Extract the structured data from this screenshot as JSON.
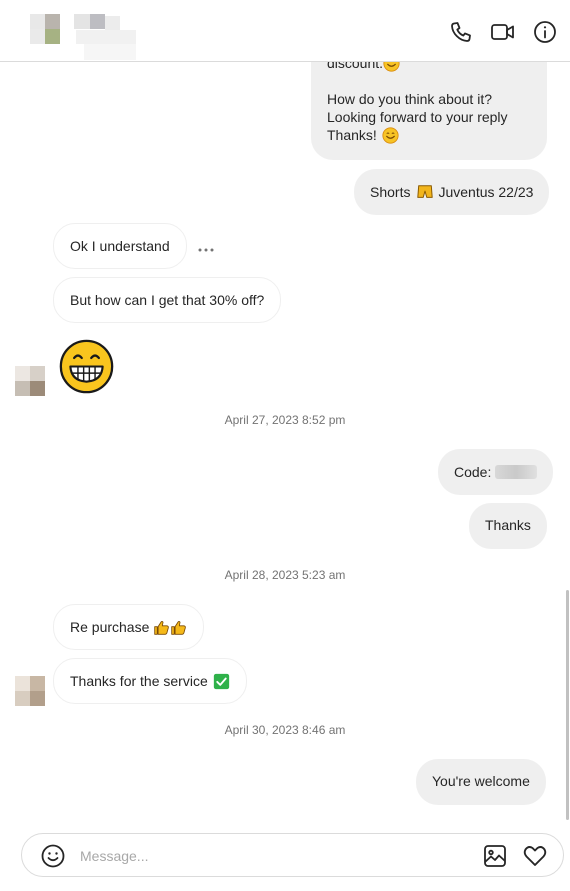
{
  "header": {
    "icons": [
      "phone-icon",
      "video-icon",
      "info-icon"
    ]
  },
  "messages": {
    "m1": {
      "line1": "discount.",
      "line2": "How do you think about it?",
      "line3": "Looking forward to your reply",
      "line4": "Thanks!"
    },
    "m2": {
      "text_a": "Shorts",
      "text_b": "Juventus 22/23"
    },
    "m3": {
      "text": "Ok I understand"
    },
    "m4": {
      "text": "But how can I get that 30% off?"
    },
    "m6": {
      "text": "Code:"
    },
    "m7": {
      "text": "Thanks"
    },
    "m8": {
      "text": "Re purchase"
    },
    "m9": {
      "text": "Thanks for the service"
    },
    "m10": {
      "text": "You're welcome"
    }
  },
  "timestamps": {
    "t1": "April 27, 2023 8:52 pm",
    "t2": "April 28, 2023 5:23 am",
    "t3": "April 30, 2023 8:46 am"
  },
  "composer": {
    "placeholder": "Message..."
  },
  "colors": {
    "incoming_bubble": "#ffffff",
    "outgoing_bubble": "#efefef",
    "text": "#262626",
    "muted": "#737373",
    "border": "#dbdbdb"
  }
}
